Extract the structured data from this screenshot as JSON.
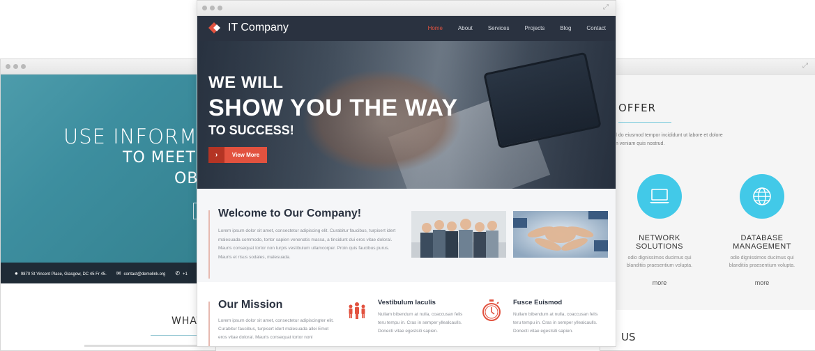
{
  "left_window": {
    "headline1": "USE INFORMAT",
    "headline2": "TO MEET",
    "headline3": "OB",
    "footer_address": "9870 St Vincent Place, Glasgow, DC 45 Fr 45.",
    "footer_email": "contact@demolink.org",
    "footer_phone": "+1",
    "section_title": "WHAT"
  },
  "right_window": {
    "section_title": "OFFER",
    "intro_line1": "d do eiusmod tempor incididunt ut labore et dolore",
    "intro_line2": "m veniam quis nostrud.",
    "services": [
      {
        "icon": "laptop-icon",
        "title_line1": "NETWORK",
        "title_line2": "SOLUTIONS",
        "desc_line1": "odio dignissimos ducimus qui",
        "desc_line2": "blanditiis praesentium volupta.",
        "more": "more"
      },
      {
        "icon": "globe-icon",
        "title_line1": "DATABASE",
        "title_line2": "MANAGEMENT",
        "desc_line1": "odio dignissimos ducimus qui",
        "desc_line2": "blanditiis praesentium volupta.",
        "more": "more"
      }
    ],
    "bottom_title": "US"
  },
  "center_window": {
    "brand": "IT Company",
    "nav": [
      "Home",
      "About",
      "Services",
      "Projects",
      "Blog",
      "Contact"
    ],
    "active_nav": "Home",
    "hero": {
      "line1": "WE WILL",
      "line2": "SHOW YOU THE WAY",
      "line3": "TO SUCCESS!",
      "button": "View More"
    },
    "welcome": {
      "title": "Welcome to Our Company!",
      "text": "Lorem ipsum dolor sit amet, consectetur adipiscing elit. Curabitur faucibus, turpisert idert malesuada commodo, tortor sapien venenatis massa, a tincidunt dui eros vitae doloral. Mauris consequat tortor non turpis vestibulum ullamcorper. Proin quis faucibus purus. Mauris et risus sodales, malesuada."
    },
    "mission": {
      "title": "Our Mission",
      "text": "Lorem ipsum dolor sit amet, consectetur adipiscingter elit. Curabitur faucibus, turpisert idert malesuada allei Emot eros vitae doloral. Mauris consequat tortor nonl",
      "columns": [
        {
          "icon": "team-icon",
          "title": "Vestibulum Iaculis",
          "text": "Nullam bibendum at nulla, coaccusan felis teru tempu in. Cras in semper yllealcaulls. Donecti vitae egestsiti sapien."
        },
        {
          "icon": "stopwatch-icon",
          "title": "Fusce Euismod",
          "text": "Nullam bibendum at nulla, coaccusan felis teru tempu in. Cras in semper yllealcaulls. Donecti vitae egestsiti sapien."
        }
      ]
    }
  },
  "colors": {
    "accent": "#e2523f",
    "nav_bg": "#2a3240",
    "teal": "#3d8e9f",
    "cyan": "#42c9e8"
  }
}
